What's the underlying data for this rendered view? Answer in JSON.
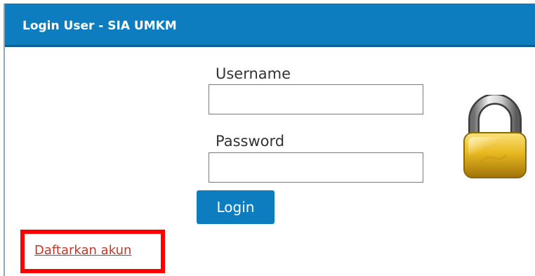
{
  "header": {
    "title": "Login User - SIA UMKM"
  },
  "form": {
    "username_label": "Username",
    "username_value": "",
    "password_label": "Password",
    "password_value": "",
    "login_label": "Login"
  },
  "register": {
    "link_label": "Daftarkan akun"
  },
  "icons": {
    "lock": "lock-icon"
  },
  "colors": {
    "header_bg": "#0d7dc0",
    "button_bg": "#0d7dc0",
    "link": "#c0392b",
    "highlight": "#ff0000"
  }
}
